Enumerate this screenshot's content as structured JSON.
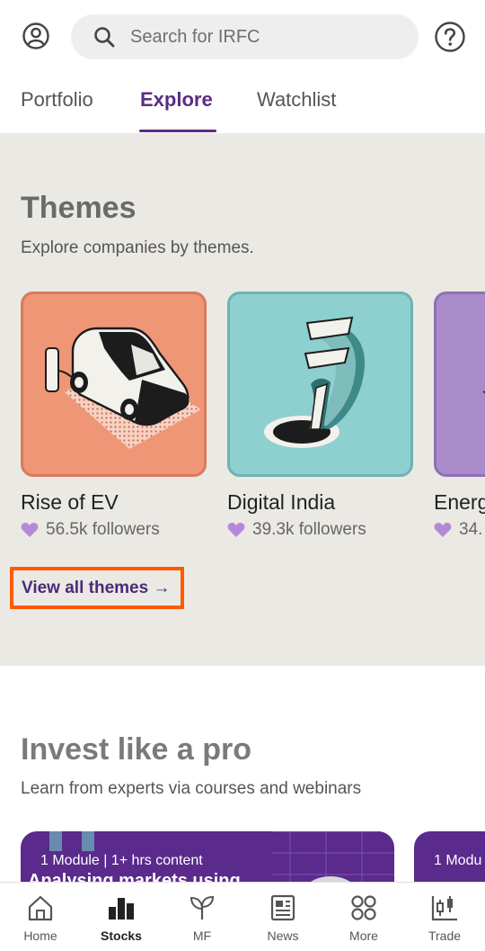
{
  "search": {
    "placeholder": "Search for IRFC"
  },
  "tabs": [
    {
      "label": "Portfolio"
    },
    {
      "label": "Explore",
      "active": true
    },
    {
      "label": "Watchlist"
    }
  ],
  "themes": {
    "title": "Themes",
    "subtitle": "Explore companies by themes.",
    "cards": [
      {
        "name": "Rise of EV",
        "followers": "56.5k followers",
        "bg": "#ef9677",
        "border": "#d87b5c"
      },
      {
        "name": "Digital India",
        "followers": "39.3k followers",
        "bg": "#8ecfcf",
        "border": "#6cb3b4"
      },
      {
        "name": "Energ",
        "followers": "34.",
        "bg": "#a98cc9",
        "border": "#8e70b4"
      }
    ],
    "view_all_label": "View all themes →"
  },
  "invest": {
    "title": "Invest like a pro",
    "subtitle": "Learn from experts via courses and webinars",
    "courses": [
      {
        "meta": "1 Module | 1+ hrs content",
        "title": "Analysing markets using"
      },
      {
        "meta": "1 Modu"
      }
    ]
  },
  "bottom_nav": [
    {
      "label": "Home",
      "icon": "home-icon"
    },
    {
      "label": "Stocks",
      "icon": "bar-chart-icon",
      "active": true
    },
    {
      "label": "MF",
      "icon": "sprout-icon"
    },
    {
      "label": "News",
      "icon": "newspaper-icon"
    },
    {
      "label": "More",
      "icon": "grid-icon"
    },
    {
      "label": "Trade",
      "icon": "candlestick-icon"
    }
  ],
  "colors": {
    "accent": "#5a2d82",
    "highlight_box": "#ff5a00",
    "themes_bg": "#ebe9e4",
    "heart": "#b48ad8"
  }
}
